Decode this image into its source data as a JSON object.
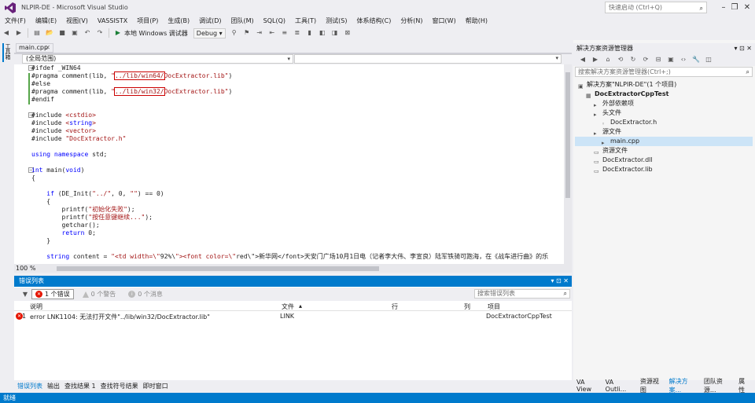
{
  "window": {
    "title": "NLPIR-DE - Microsoft Visual Studio",
    "quick_launch_placeholder": "快速启动 (Ctrl+Q)"
  },
  "menu": [
    "文件(F)",
    "编辑(E)",
    "视图(V)",
    "VASSISTX",
    "项目(P)",
    "生成(B)",
    "调试(D)",
    "团队(M)",
    "SQL(Q)",
    "工具(T)",
    "测试(S)",
    "体系结构(C)",
    "分析(N)",
    "窗口(W)",
    "帮助(H)"
  ],
  "toolbar": {
    "run_label": "本地 Windows 调试器",
    "config": "Debug"
  },
  "left_strip": {
    "tab": "工具箱"
  },
  "editor": {
    "tab": "main.cpp",
    "scope": "(全局范围)",
    "zoom": "100 %",
    "lines": [
      "#ifdef _WIN64",
      "#pragma comment(lib, \"../lib/win64/DocExtractor.lib\")",
      "#else",
      "#pragma comment(lib, \"../lib/win32/DocExtractor.lib\")",
      "#endif",
      "",
      "#include <cstdio>",
      "#include <string>",
      "#include <vector>",
      "#include \"DocExtractor.h\"",
      "",
      "using namespace std;",
      "",
      "int main(void)",
      "{",
      "",
      "    if (DE_Init(\"../\", 0, \"\") == 0)",
      "    {",
      "        printf(\"初始化失败\");",
      "        printf(\"按任意键继续...\");",
      "        getchar();",
      "        return 0;",
      "    }",
      "",
      "    string content = \"<td width=\\\"92%\\\"><font color=\\\"red\\\">新华网</font>天安门广场10月1日电（记者李大伟、李宣良）陆军铁骑可跑海，在《战车进行曲》的乐"
    ]
  },
  "error_list": {
    "title": "错误列表",
    "errors_btn": "1 个错误",
    "warnings_btn": "0 个警告",
    "messages_btn": "0 个消息",
    "search_placeholder": "搜索错误列表",
    "columns": {
      "desc": "说明",
      "file": "文件",
      "line": "行",
      "col": "列",
      "project": "项目"
    },
    "rows": [
      {
        "num": "1",
        "desc": "error LNK1104: 无法打开文件\"../lib/win32/DocExtractor.lib\"",
        "file": "LINK",
        "line": "",
        "col": "",
        "project": "DocExtractorCppTest"
      }
    ]
  },
  "bottom_tabs": [
    "错误列表",
    "输出",
    "查找结果 1",
    "查找符号结果",
    "即时窗口"
  ],
  "solution_explorer": {
    "title": "解决方案资源管理器",
    "search_placeholder": "搜索解决方案资源管理器(Ctrl+;)",
    "tree": [
      {
        "label": "解决方案\"NLPIR-DE\"(1 个项目)",
        "indent": 0,
        "bold": false
      },
      {
        "label": "DocExtractorCppTest",
        "indent": 1,
        "bold": true
      },
      {
        "label": "外部依赖项",
        "indent": 2,
        "bold": false
      },
      {
        "label": "头文件",
        "indent": 2,
        "bold": false
      },
      {
        "label": "DocExtractor.h",
        "indent": 3,
        "bold": false
      },
      {
        "label": "源文件",
        "indent": 2,
        "bold": false
      },
      {
        "label": "main.cpp",
        "indent": 3,
        "bold": false,
        "selected": true
      },
      {
        "label": "资源文件",
        "indent": 2,
        "bold": false
      },
      {
        "label": "DocExtractor.dll",
        "indent": 2,
        "bold": false
      },
      {
        "label": "DocExtractor.lib",
        "indent": 2,
        "bold": false
      }
    ]
  },
  "right_tabs": [
    "VA View",
    "VA Outli...",
    "资源视图",
    "解决方案...",
    "团队资源...",
    "属性"
  ],
  "status": "就绪",
  "colors": {
    "accent": "#007acc",
    "error": "#e51400"
  }
}
